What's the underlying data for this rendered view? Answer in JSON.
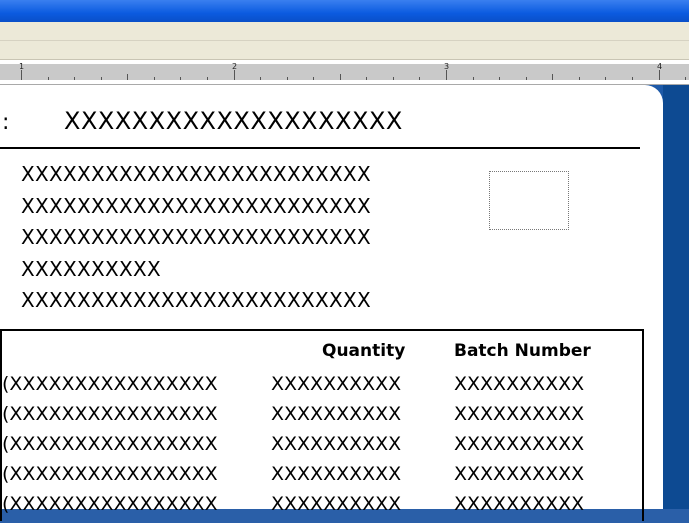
{
  "page": {
    "label_prefix": ":",
    "title_value": "XXXXXXXXXXXXXXXXXXXX",
    "address_lines": [
      "XXXXXXXXXXXXXXXXXXXXXXXXX",
      "XXXXXXXXXXXXXXXXXXXXXXXXX",
      "XXXXXXXXXXXXXXXXXXXXXXXXX",
      "XXXXXXXXXX",
      "XXXXXXXXXXXXXXXXXXXXXXXXX"
    ]
  },
  "ruler": {
    "numbers": [
      "1",
      "2",
      "3",
      "4"
    ]
  },
  "table": {
    "headers": {
      "quantity": "Quantity",
      "batch_number": "Batch Number"
    },
    "rows": [
      {
        "description": "(XXXXXXXXXXXXXXXX",
        "quantity": "XXXXXXXXXX",
        "batch": "XXXXXXXXXX"
      },
      {
        "description": "(XXXXXXXXXXXXXXXX",
        "quantity": "XXXXXXXXXX",
        "batch": "XXXXXXXXXX"
      },
      {
        "description": "(XXXXXXXXXXXXXXXX",
        "quantity": "XXXXXXXXXX",
        "batch": "XXXXXXXXXX"
      },
      {
        "description": "(XXXXXXXXXXXXXXXX",
        "quantity": "XXXXXXXXXX",
        "batch": "XXXXXXXXXX"
      },
      {
        "description": "(XXXXXXXXXXXXXXXX",
        "quantity": "XXXXXXXXXX",
        "batch": "XXXXXXXXXX"
      }
    ]
  },
  "colors": {
    "title_bar": "#0b5be0",
    "chrome": "#ece9d8",
    "workspace": "#1e5aa8",
    "page": "#ffffff"
  }
}
